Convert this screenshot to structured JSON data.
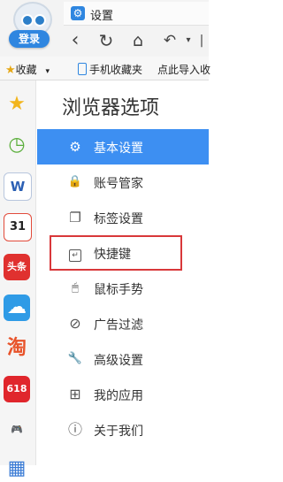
{
  "window": {
    "tab_title": "设置"
  },
  "account": {
    "login_label": "登录"
  },
  "bookmarks_bar": {
    "favorites_label": "收藏",
    "mobile_favorites_label": "手机收藏夹",
    "import_label": "点此导入收"
  },
  "settings": {
    "title": "浏览器选项",
    "menu": [
      {
        "label": "基本设置",
        "icon": "gear-icon",
        "glyph": "⚙",
        "active": true
      },
      {
        "label": "账号管家",
        "icon": "lock-icon",
        "glyph": "🔒"
      },
      {
        "label": "标签设置",
        "icon": "tabs-icon",
        "glyph": "❐"
      },
      {
        "label": "快捷键",
        "icon": "keyboard-shortcut-icon",
        "glyph": "↵",
        "highlighted": true
      },
      {
        "label": "鼠标手势",
        "icon": "mouse-icon",
        "glyph": "🖱"
      },
      {
        "label": "广告过滤",
        "icon": "block-icon",
        "glyph": "⃠"
      },
      {
        "label": "高级设置",
        "icon": "wrench-icon",
        "glyph": "🔧"
      },
      {
        "label": "我的应用",
        "icon": "apps-icon",
        "glyph": "⊞"
      },
      {
        "label": "关于我们",
        "icon": "info-icon",
        "glyph": "ⓘ"
      }
    ]
  },
  "sidebar_apps": [
    {
      "name": "favorites-star-icon",
      "text": "★",
      "color": "#f2b51d"
    },
    {
      "name": "clock-icon",
      "text": "◷",
      "color": "#5aae3a"
    },
    {
      "name": "word-doc-icon",
      "text": "W",
      "color": "#2b5fb4"
    },
    {
      "name": "calendar-icon",
      "text": "31",
      "color": "#e24b3b"
    },
    {
      "name": "toutiao-icon",
      "text": "头条",
      "color": "#e0312f"
    },
    {
      "name": "weather-icon",
      "text": "☁",
      "color": "#2f9be6"
    },
    {
      "name": "taobao-icon",
      "text": "淘",
      "color": "#e8532a"
    },
    {
      "name": "shopping-618-icon",
      "text": "618",
      "color": "#e0262c"
    },
    {
      "name": "game-controller-icon",
      "text": "🎮",
      "color": "#3d8ff2"
    },
    {
      "name": "video-film-icon",
      "text": "▦",
      "color": "#3a7bd5"
    }
  ]
}
